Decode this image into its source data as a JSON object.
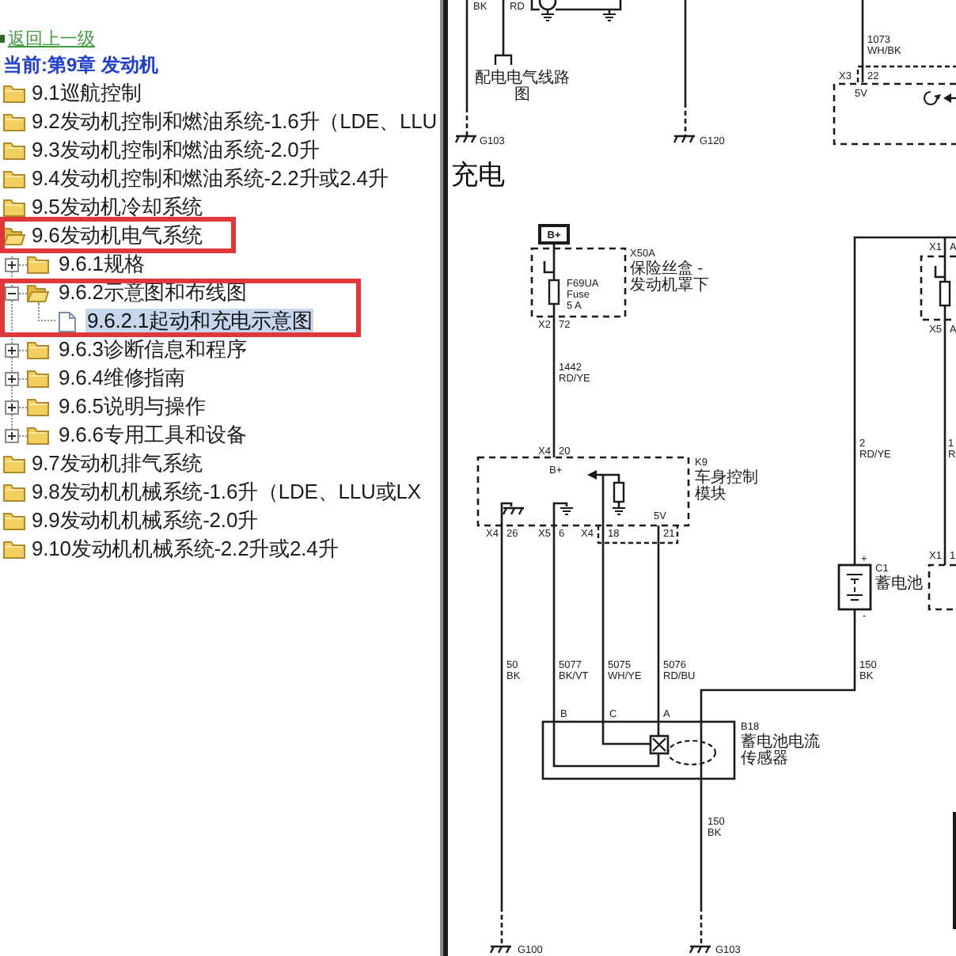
{
  "navigation": {
    "back_link": "返回上一级",
    "current_location": "当前:第9章 发动机"
  },
  "tree": [
    {
      "label": "9.1巡航控制",
      "kind": "folder",
      "expanded": false,
      "selected": false,
      "framed": false,
      "framed_with_children": false
    },
    {
      "label": "9.2发动机控制和燃油系统-1.6升（LDE、LLU",
      "kind": "folder",
      "expanded": false,
      "selected": false,
      "framed": false,
      "framed_with_children": false
    },
    {
      "label": "9.3发动机控制和燃油系统-2.0升",
      "kind": "folder",
      "expanded": false,
      "selected": false,
      "framed": false,
      "framed_with_children": false
    },
    {
      "label": "9.4发动机控制和燃油系统-2.2升或2.4升",
      "kind": "folder",
      "expanded": false,
      "selected": false,
      "framed": false,
      "framed_with_children": false
    },
    {
      "label": "9.5发动机冷却系统",
      "kind": "folder",
      "expanded": false,
      "selected": false,
      "framed": false,
      "framed_with_children": false
    },
    {
      "label": "9.6发动机电气系统",
      "kind": "folder",
      "expanded": true,
      "selected": false,
      "framed": true,
      "framed_with_children": false,
      "children": [
        {
          "label": "9.6.1规格",
          "kind": "folder",
          "expanded": false,
          "selected": false,
          "framed": false,
          "framed_with_children": false
        },
        {
          "label": "9.6.2示意图和布线图",
          "kind": "folder",
          "expanded": true,
          "selected": false,
          "framed": false,
          "framed_with_children": true,
          "children": [
            {
              "label": "9.6.2.1起动和充电示意图",
              "kind": "document",
              "selected": true,
              "framed": false,
              "framed_with_children": false
            }
          ]
        },
        {
          "label": "9.6.3诊断信息和程序",
          "kind": "folder",
          "expanded": false,
          "selected": false,
          "framed": false,
          "framed_with_children": false
        },
        {
          "label": "9.6.4维修指南",
          "kind": "folder",
          "expanded": false,
          "selected": false,
          "framed": false,
          "framed_with_children": false
        },
        {
          "label": "9.6.5说明与操作",
          "kind": "folder",
          "expanded": false,
          "selected": false,
          "framed": false,
          "framed_with_children": false
        },
        {
          "label": "9.6.6专用工具和设备",
          "kind": "folder",
          "expanded": false,
          "selected": false,
          "framed": false,
          "framed_with_children": false
        }
      ]
    },
    {
      "label": "9.7发动机排气系统",
      "kind": "folder",
      "expanded": false,
      "selected": false,
      "framed": false,
      "framed_with_children": false
    },
    {
      "label": "9.8发动机机械系统-1.6升（LDE、LLU或LX",
      "kind": "folder",
      "expanded": false,
      "selected": false,
      "framed": false,
      "framed_with_children": false
    },
    {
      "label": "9.9发动机机械系统-2.0升",
      "kind": "folder",
      "expanded": false,
      "selected": false,
      "framed": false,
      "framed_with_children": false
    },
    {
      "label": "9.10发动机机械系统-2.2升或2.4升",
      "kind": "folder",
      "expanded": false,
      "selected": false,
      "framed": false,
      "framed_with_children": false
    }
  ],
  "diagram": {
    "heading": "充电",
    "wire_labels": [
      {
        "lines": [
          "BK"
        ]
      },
      {
        "lines": [
          "RD"
        ]
      },
      {
        "lines": [
          "1073",
          "WH/BK"
        ]
      },
      {
        "lines": [
          "1442",
          "RD/YE"
        ]
      },
      {
        "lines": [
          "2",
          "RD/YE"
        ]
      },
      {
        "lines": [
          "1",
          "R"
        ]
      },
      {
        "lines": [
          "50",
          "BK"
        ]
      },
      {
        "lines": [
          "5077",
          "BK/VT"
        ]
      },
      {
        "lines": [
          "5075",
          "WH/YE"
        ]
      },
      {
        "lines": [
          "5076",
          "RD/BU"
        ]
      },
      {
        "lines": [
          "150",
          "BK"
        ]
      },
      {
        "lines": [
          "150",
          "BK"
        ]
      }
    ],
    "pin_labels": [
      "X3",
      "22",
      "X1",
      "A",
      "X2",
      "72",
      "X5",
      "A",
      "X4",
      "20",
      "X4",
      "26",
      "X5",
      "6",
      "X4",
      "18",
      "21",
      "X1",
      "1",
      "B",
      "C",
      "A"
    ],
    "terminal_labels": [
      {
        "kind": "plain",
        "text": "5V"
      },
      {
        "kind": "boxed",
        "text": "B+"
      },
      {
        "kind": "plain",
        "text": "B+"
      },
      {
        "kind": "plain",
        "text": "5V"
      },
      {
        "kind": "plain",
        "text": "+"
      },
      {
        "kind": "plain",
        "text": "-"
      }
    ],
    "component_labels": [
      {
        "lines": [
          "配电电气线路",
          "图"
        ]
      },
      {
        "lines": [
          "X50A",
          "保险丝盒 -",
          "发动机罩下"
        ]
      },
      {
        "lines": [
          "F69UA",
          "Fuse",
          "5 A"
        ]
      },
      {
        "lines": [
          "K9",
          "车身控制",
          "模块"
        ]
      },
      {
        "lines": [
          "C1",
          "蓄电池"
        ]
      },
      {
        "lines": [
          "B18",
          "蓄电池电流",
          "传感器"
        ]
      }
    ],
    "ground_labels": [
      "G103",
      "G120",
      "G100",
      "G103"
    ]
  }
}
